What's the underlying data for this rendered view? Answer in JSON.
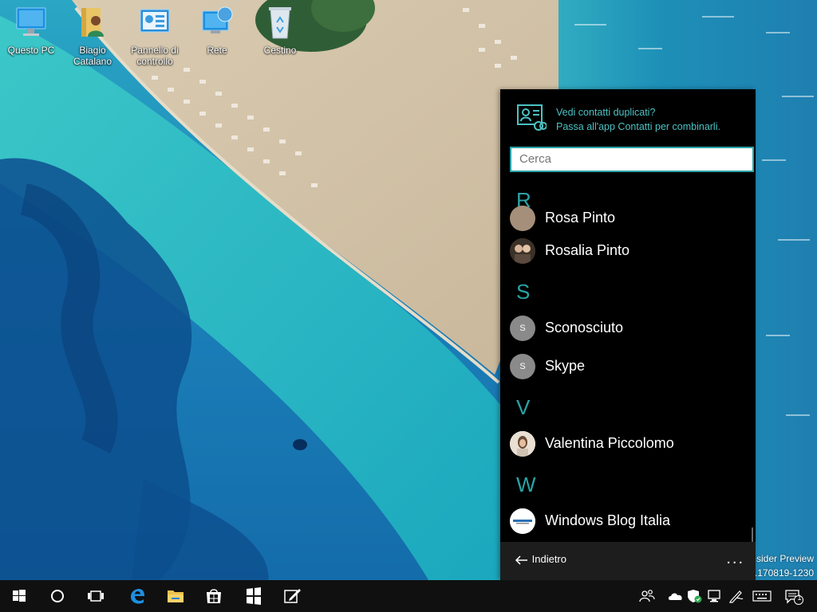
{
  "desktop": {
    "icons": [
      {
        "label": "Questo PC",
        "icon": "computer-icon"
      },
      {
        "label": "Biagio Catalano",
        "icon": "user-folder-icon"
      },
      {
        "label": "Pannello di controllo",
        "icon": "control-panel-icon"
      },
      {
        "label": "Rete",
        "icon": "network-icon"
      },
      {
        "label": "Cestino",
        "icon": "recycle-bin-icon"
      }
    ],
    "watermark_line1": "Insider Preview",
    "watermark_line2": "e.170819-1230"
  },
  "people_pane": {
    "banner_line1": "Vedi contatti duplicati?",
    "banner_line2": "Passa all'app Contatti per combinarli.",
    "search_placeholder": "Cerca",
    "groups": [
      {
        "letter": "R",
        "contacts": [
          {
            "name": "Rosa Pinto",
            "avatar": "photo"
          },
          {
            "name": "Rosalia Pinto",
            "avatar": "photo"
          }
        ]
      },
      {
        "letter": "S",
        "contacts": [
          {
            "name": "Sconosciuto",
            "avatar": "S"
          },
          {
            "name": "Skype",
            "avatar": "S"
          }
        ]
      },
      {
        "letter": "V",
        "contacts": [
          {
            "name": "Valentina Piccolomo",
            "avatar": "photo"
          }
        ]
      },
      {
        "letter": "W",
        "contacts": [
          {
            "name": "Windows Blog Italia",
            "avatar": "logo"
          }
        ]
      }
    ],
    "back_label": "Indietro",
    "more_label": "..."
  },
  "taskbar": {
    "apps": [
      "start-icon",
      "cortana-icon",
      "task-view-icon",
      "edge-icon",
      "file-explorer-icon",
      "store-icon",
      "windows-defender-icon",
      "ink-note-icon"
    ],
    "tray": [
      "people-icon",
      "onedrive-icon",
      "security-icon",
      "network-icon",
      "pen-icon",
      "keyboard-icon",
      "action-center-icon"
    ],
    "notification_count": "1",
    "accent": "#2aa3a6"
  }
}
